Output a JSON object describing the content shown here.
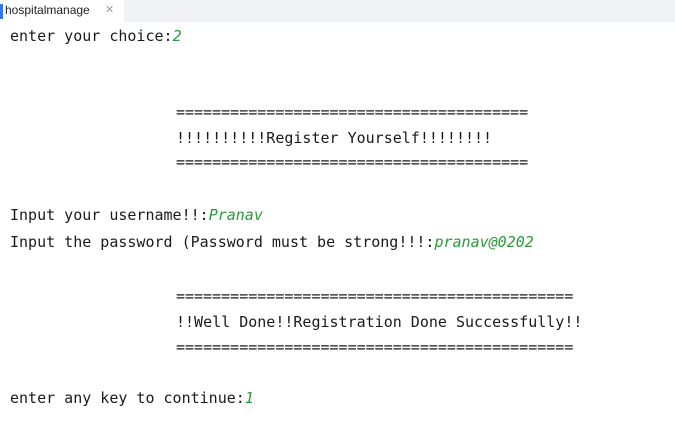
{
  "tab": {
    "title": "hospitalmanage",
    "close_icon": "close-icon"
  },
  "console": {
    "line1_prompt": "enter your choice:",
    "line1_input": "2",
    "banner1_top": "=======================================",
    "banner1_text": "!!!!!!!!!!Register Yourself!!!!!!!!",
    "banner1_bottom": "=======================================",
    "username_prompt": "Input your username!!:",
    "username_input": "Pranav",
    "password_prompt": "Input the password (Password must be strong!!!:",
    "password_input": "pranav@0202",
    "banner2_top": "============================================",
    "banner2_text": "!!Well Done!!Registration Done Successfully!!",
    "banner2_bottom": "============================================",
    "continue_prompt": "enter any key to continue:",
    "continue_input": "1"
  },
  "colors": {
    "input_text": "#2b9a3a",
    "tab_accent": "#3574f0"
  }
}
